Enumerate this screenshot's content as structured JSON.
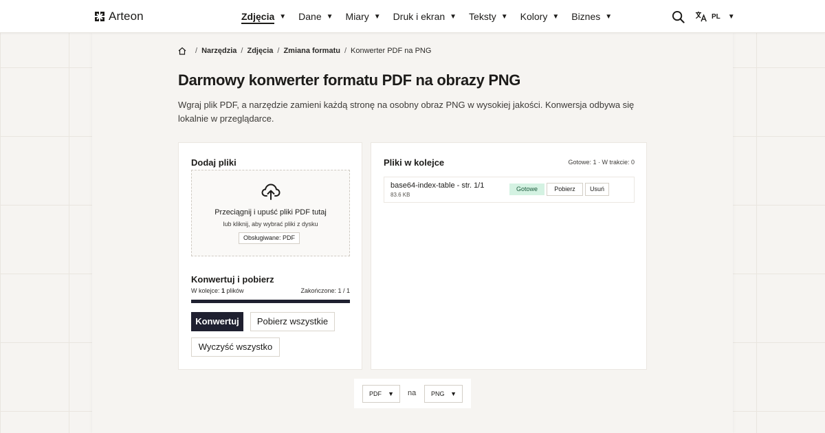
{
  "brand": {
    "name": "Arteon"
  },
  "nav": {
    "items": [
      {
        "label": "Zdjęcia",
        "active": true
      },
      {
        "label": "Dane"
      },
      {
        "label": "Miary"
      },
      {
        "label": "Druk i ekran"
      },
      {
        "label": "Teksty"
      },
      {
        "label": "Kolory"
      },
      {
        "label": "Biznes"
      }
    ],
    "caret": "▼"
  },
  "language": {
    "code": "PL"
  },
  "breadcrumb": {
    "items": [
      "Narzędzia",
      "Zdjęcia",
      "Zmiana formatu"
    ],
    "current": "Konwerter PDF na PNG",
    "separator": "/"
  },
  "page": {
    "title": "Darmowy konwerter formatu PDF na obrazy PNG",
    "description": "Wgraj plik PDF, a narzędzie zamieni każdą stronę na osobny obraz PNG w wysokiej jakości. Konwersja odbywa się lokalnie w przeglądarce."
  },
  "upload": {
    "heading": "Dodaj pliki",
    "drop_main": "Przeciągnij i upuść pliki PDF tutaj",
    "drop_sub": "lub kliknij, aby wybrać pliki z dysku",
    "supported": "Obsługiwane: PDF"
  },
  "convert": {
    "heading": "Konwertuj i pobierz",
    "queue_prefix": "W kolejce: ",
    "queue_count": "1",
    "queue_suffix": " plików",
    "done_text": "Zakończone: 1 / 1",
    "progress": 1.0,
    "convert_label": "Konwertuj",
    "download_all_label": "Pobierz wszystkie",
    "clear_all_label": "Wyczyść wszystko"
  },
  "queue": {
    "heading": "Pliki w kolejce",
    "stats": "Gotowe: 1 · W trakcie: 0",
    "files": [
      {
        "name": "base64-index-table - str. 1/1",
        "size": "83.6 KB",
        "status": "Gotowe",
        "download_label": "Pobierz",
        "remove_label": "Usuń"
      }
    ]
  },
  "format_switch": {
    "from": "PDF",
    "joiner": "na",
    "to": "PNG"
  },
  "colors": {
    "primary": "#1f2030",
    "success_bg": "#d4f2e2",
    "background": "#f6f4f1"
  },
  "icons": [
    "logo-icon",
    "search-icon",
    "translate-icon",
    "home-icon",
    "upload-cloud-icon"
  ]
}
